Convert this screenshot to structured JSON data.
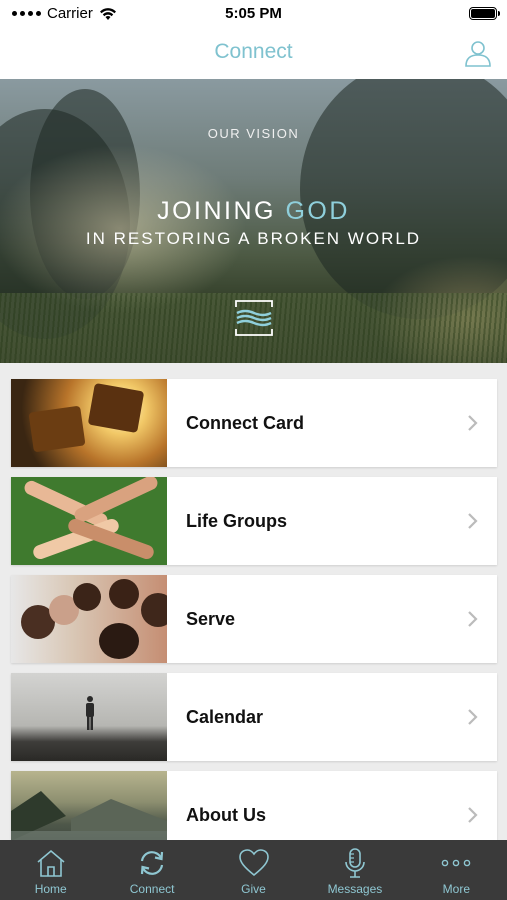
{
  "status_bar": {
    "carrier": "Carrier",
    "time": "5:05 PM"
  },
  "nav": {
    "title": "Connect",
    "profile_icon": "person-icon"
  },
  "hero": {
    "label": "OUR VISION",
    "headline_part1": "JOINING",
    "headline_accent": "GOD",
    "headline_line2": "IN RESTORING A BROKEN WORLD",
    "accent_color": "#8fcfdb"
  },
  "cards": [
    {
      "label": "Connect Card",
      "image": "puzzle-pieces"
    },
    {
      "label": "Life Groups",
      "image": "joined-hands"
    },
    {
      "label": "Serve",
      "image": "children-group"
    },
    {
      "label": "Calendar",
      "image": "person-on-cliff"
    },
    {
      "label": "About Us",
      "image": "mountain-lake"
    }
  ],
  "tabs": [
    {
      "label": "Home",
      "icon": "house-icon"
    },
    {
      "label": "Connect",
      "icon": "sync-icon",
      "active": true
    },
    {
      "label": "Give",
      "icon": "heart-icon"
    },
    {
      "label": "Messages",
      "icon": "microphone-icon"
    },
    {
      "label": "More",
      "icon": "more-dots-icon"
    }
  ],
  "colors": {
    "accent": "#7fc2cf",
    "tab_bar": "#3a3a3a"
  }
}
